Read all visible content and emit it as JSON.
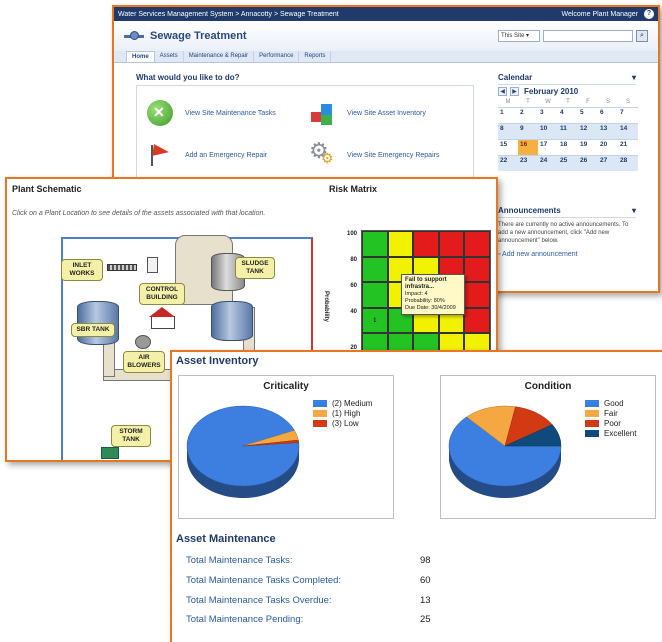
{
  "site": {
    "breadcrumb": "Water Services Management System > Annacotty > Sewage Treatment",
    "welcome": "Welcome Plant Manager",
    "title": "Sewage Treatment",
    "search_scope": "This Site",
    "nav": [
      "Home",
      "Assets",
      "Maintenance & Repair",
      "Performance",
      "Reports"
    ]
  },
  "what_to_do": {
    "heading": "What would you like to do?",
    "tasks": [
      {
        "label": "View Site Maintenance Tasks",
        "icon": "wrench-icon"
      },
      {
        "label": "View Site Asset Inventory",
        "icon": "cubes-icon"
      },
      {
        "label": "Add an Emergency Repair",
        "icon": "flag-icon"
      },
      {
        "label": "View Site Emergency Repairs",
        "icon": "gears-icon"
      }
    ]
  },
  "calendar": {
    "heading": "Calendar",
    "month": "February 2010",
    "weekdays": [
      "M",
      "T",
      "W",
      "T",
      "F",
      "S",
      "S"
    ],
    "weeks": [
      [
        "1",
        "2",
        "3",
        "4",
        "5",
        "6",
        "7"
      ],
      [
        "8",
        "9",
        "10",
        "11",
        "12",
        "13",
        "14"
      ],
      [
        "15",
        "16",
        "17",
        "18",
        "19",
        "20",
        "21"
      ],
      [
        "22",
        "23",
        "24",
        "25",
        "26",
        "27",
        "28"
      ]
    ],
    "today": "16"
  },
  "announcements": {
    "heading": "Announcements",
    "text": "There are currently no active announcements. To add a new announcement, click \"Add new announcement\" below.",
    "add_link": "Add new announcement"
  },
  "schematic": {
    "title": "Plant Schematic",
    "subtitle": "Click on a Plant Location to see details of the assets associated with that location.",
    "labels": {
      "inlet": "INLET WORKS",
      "control": "CONTROL BUILDING",
      "sludge": "SLUDGE TANK",
      "sbr": "SBR TANK",
      "blowers": "AIR BLOWERS",
      "storm": "STORM TANK"
    }
  },
  "risk_matrix": {
    "title": "Risk Matrix",
    "y_label": "Probability",
    "y_ticks": [
      "100",
      "80",
      "60",
      "40",
      "20"
    ],
    "cell_value": "1",
    "tooltip": {
      "title": "Fail to support infrastra...",
      "impact": "Impact: 4",
      "probability": "Probability: 80%",
      "due": "Due Date: 30/4/2009"
    },
    "colors": {
      "green": "#22c322",
      "yellow": "#f2f200",
      "red": "#e31b1b"
    }
  },
  "asset_inventory": {
    "title": "Asset Inventory",
    "criticality": {
      "title": "Criticality",
      "legend": [
        {
          "label": "(2) Medium",
          "color": "#3d7fe0"
        },
        {
          "label": "(1) High",
          "color": "#f5a742"
        },
        {
          "label": "(3) Low",
          "color": "#d13a12"
        }
      ],
      "values": [
        95,
        4,
        1
      ]
    },
    "condition": {
      "title": "Condition",
      "legend": [
        {
          "label": "Good",
          "color": "#3d7fe0"
        },
        {
          "label": "Fair",
          "color": "#f5a742"
        },
        {
          "label": "Poor",
          "color": "#d13a12"
        },
        {
          "label": "Excellent",
          "color": "#0f4a7a"
        }
      ],
      "values": [
        63,
        15,
        13,
        9
      ]
    }
  },
  "asset_maintenance": {
    "title": "Asset Maintenance",
    "rows": [
      {
        "label": "Total Maintenance Tasks:",
        "value": "98"
      },
      {
        "label": "Total Maintenance Tasks Completed:",
        "value": "60"
      },
      {
        "label": "Total Maintenance Tasks Overdue:",
        "value": "13"
      },
      {
        "label": "Total Maintenance Pending:",
        "value": "25"
      }
    ]
  }
}
